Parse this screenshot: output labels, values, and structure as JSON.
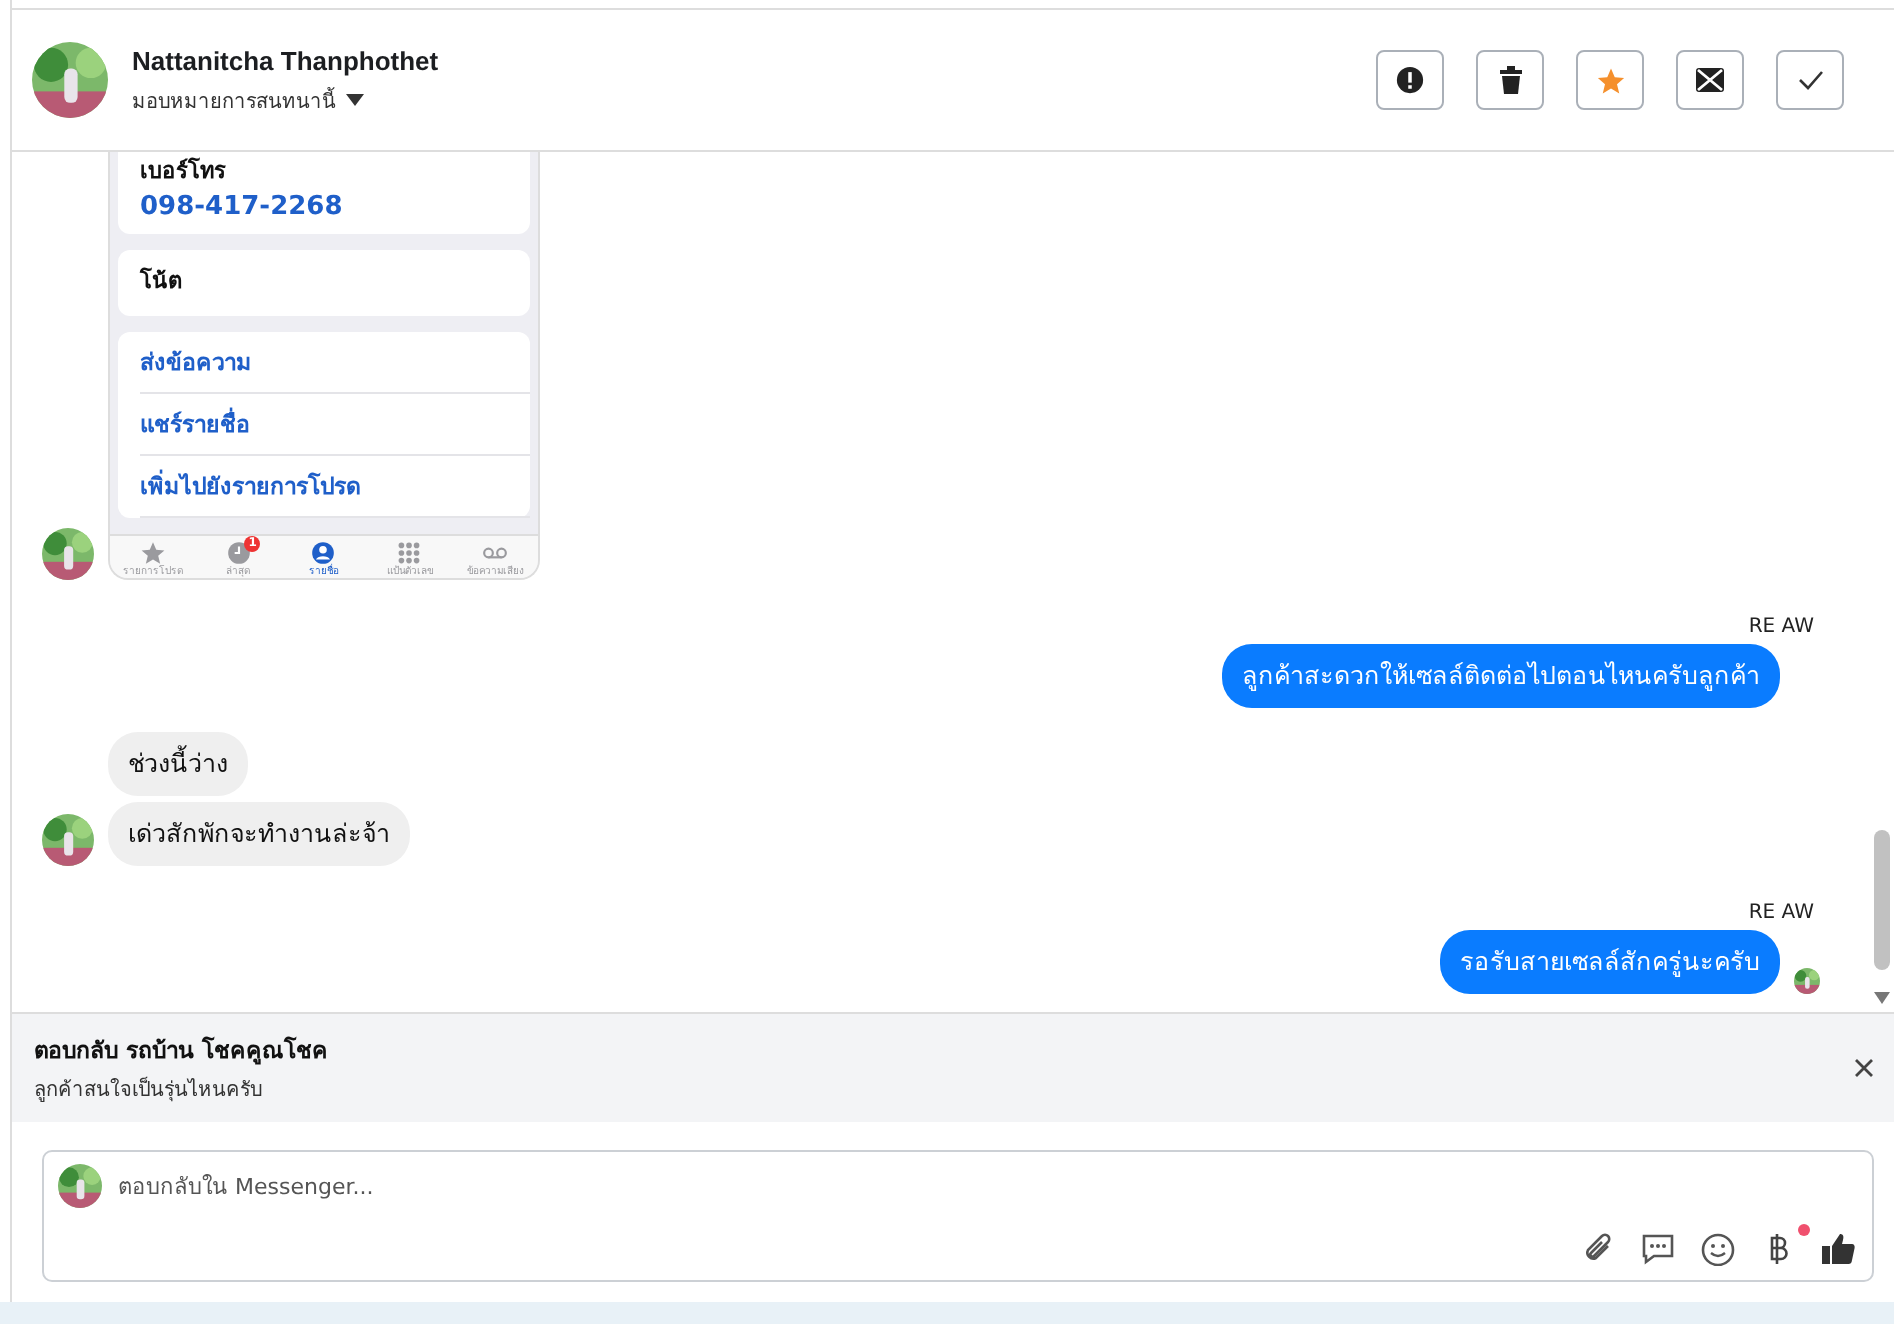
{
  "contact": {
    "name": "Nattanitcha Thanphothet",
    "subtitle": "มอบหมายการสนทนานี้"
  },
  "actions": [
    {
      "kind": "report"
    },
    {
      "kind": "delete"
    },
    {
      "kind": "star",
      "on": true
    },
    {
      "kind": "unread"
    },
    {
      "kind": "done"
    }
  ],
  "messages": [
    {
      "kind": "image",
      "outgoing": false,
      "avatar": true,
      "screenshot": {
        "phone_label": "เบอร์โทร",
        "phone_number": "098-417-2268",
        "note_label": "โน้ต",
        "links": [
          "ส่งข้อความ",
          "แชร์รายชื่อ",
          "เพิ่มไปยังรายการโปรด"
        ],
        "tabs": [
          {
            "kind": "star",
            "label": "รายการโปรด",
            "selected": false
          },
          {
            "kind": "clock",
            "label": "ล่าสุด",
            "selected": false,
            "badge": "1"
          },
          {
            "kind": "person",
            "label": "รายชื่อ",
            "selected": true
          },
          {
            "kind": "keypad",
            "label": "แป้นตัวเลข",
            "selected": false
          },
          {
            "kind": "voicemail",
            "label": "ข้อความเสียง",
            "selected": false
          }
        ]
      }
    },
    {
      "kind": "text",
      "outgoing": true,
      "sender": "RE AW",
      "text": "ลูกค้าสะดวกให้เซลล์ติดต่อไปตอนไหนครับลูกค้า",
      "avatar": false
    },
    {
      "kind": "text",
      "outgoing": false,
      "text": "ช่วงนี้ว่าง",
      "avatar": false
    },
    {
      "kind": "text",
      "outgoing": false,
      "text": "เด่วสักพักจะทำงานล่ะจ้า",
      "avatar": true
    },
    {
      "kind": "text",
      "outgoing": true,
      "sender": "RE AW",
      "text": "รอรับสายเซลล์สักครู่นะครับ",
      "avatar": true
    }
  ],
  "reply": {
    "title": "ตอบกลับ รถบ้าน โชคคูณโชค",
    "quote": "ลูกค้าสนใจเป็นรุ่นไหนครับ"
  },
  "composer": {
    "placeholder": "ตอบกลับใน Messenger...",
    "tools": [
      {
        "kind": "attach",
        "notify": false
      },
      {
        "kind": "saved-replies",
        "notify": false
      },
      {
        "kind": "emoji",
        "notify": false
      },
      {
        "kind": "payment",
        "notify": true
      },
      {
        "kind": "like",
        "notify": false
      }
    ]
  }
}
